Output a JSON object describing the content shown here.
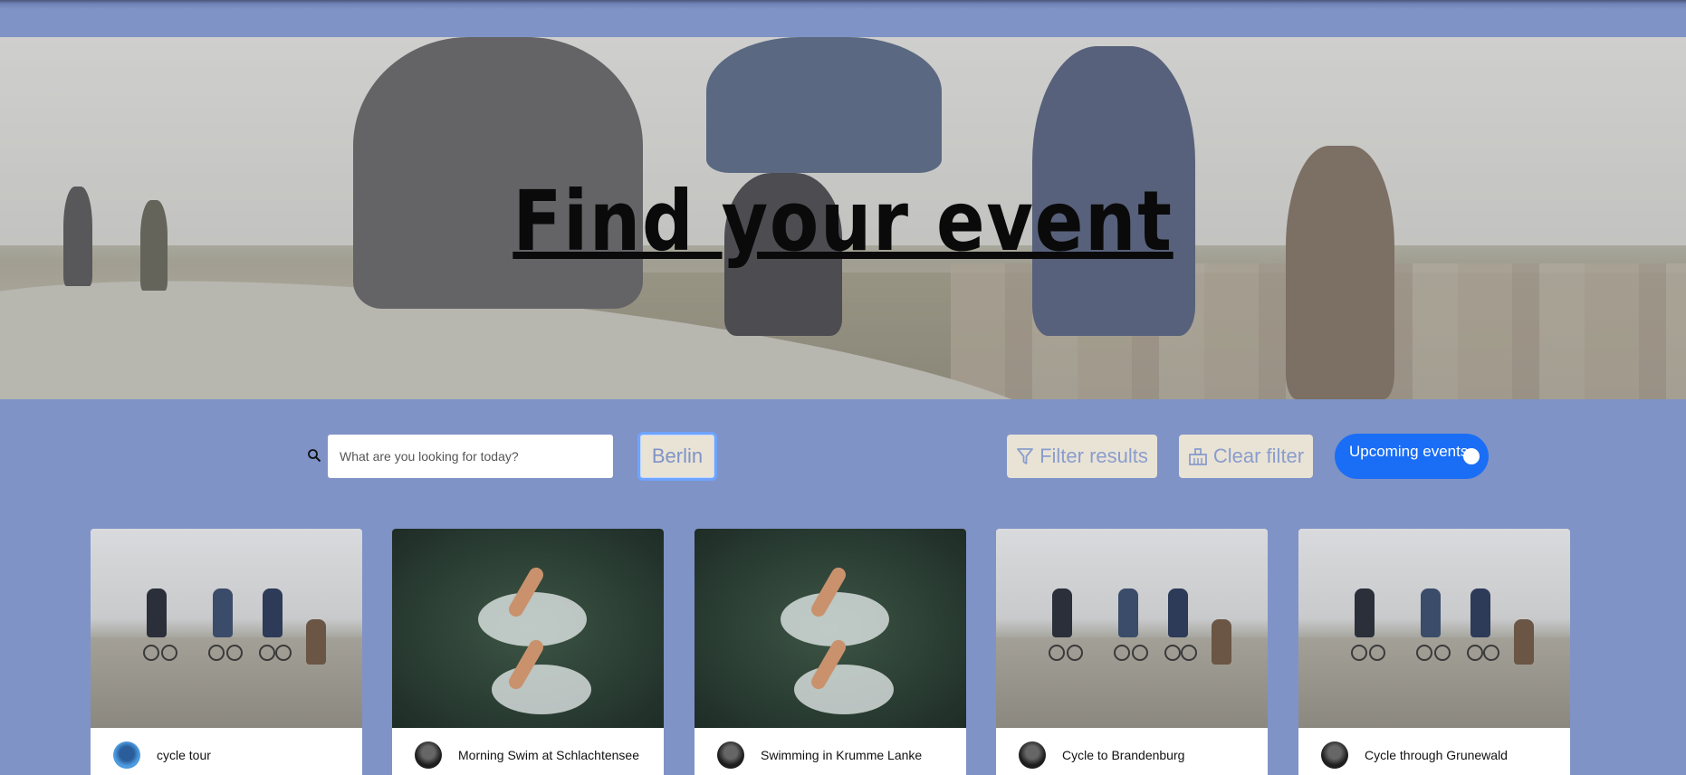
{
  "hero": {
    "title": "Find your event"
  },
  "search": {
    "placeholder": "What are you looking for today?",
    "value": ""
  },
  "toolbar": {
    "city_label": "Berlin",
    "filter_label": "Filter results",
    "clear_label": "Clear filter",
    "upcoming_label": "Upcoming events",
    "upcoming_on": true
  },
  "colors": {
    "background": "#7f93c6",
    "toggle": "#1a6ef5",
    "button_bg": "#e9e3d6"
  },
  "events": [
    {
      "title": "cycle tour",
      "image": "cycling",
      "avatar": "profile"
    },
    {
      "title": "Morning Swim at Schlachtensee",
      "image": "swimming",
      "avatar": "profile"
    },
    {
      "title": "Swimming in Krumme Lanke",
      "image": "swimming",
      "avatar": "profile"
    },
    {
      "title": "Cycle to Brandenburg",
      "image": "cycling",
      "avatar": "profile"
    },
    {
      "title": "Cycle through Grunewald",
      "image": "cycling",
      "avatar": "profile"
    }
  ]
}
